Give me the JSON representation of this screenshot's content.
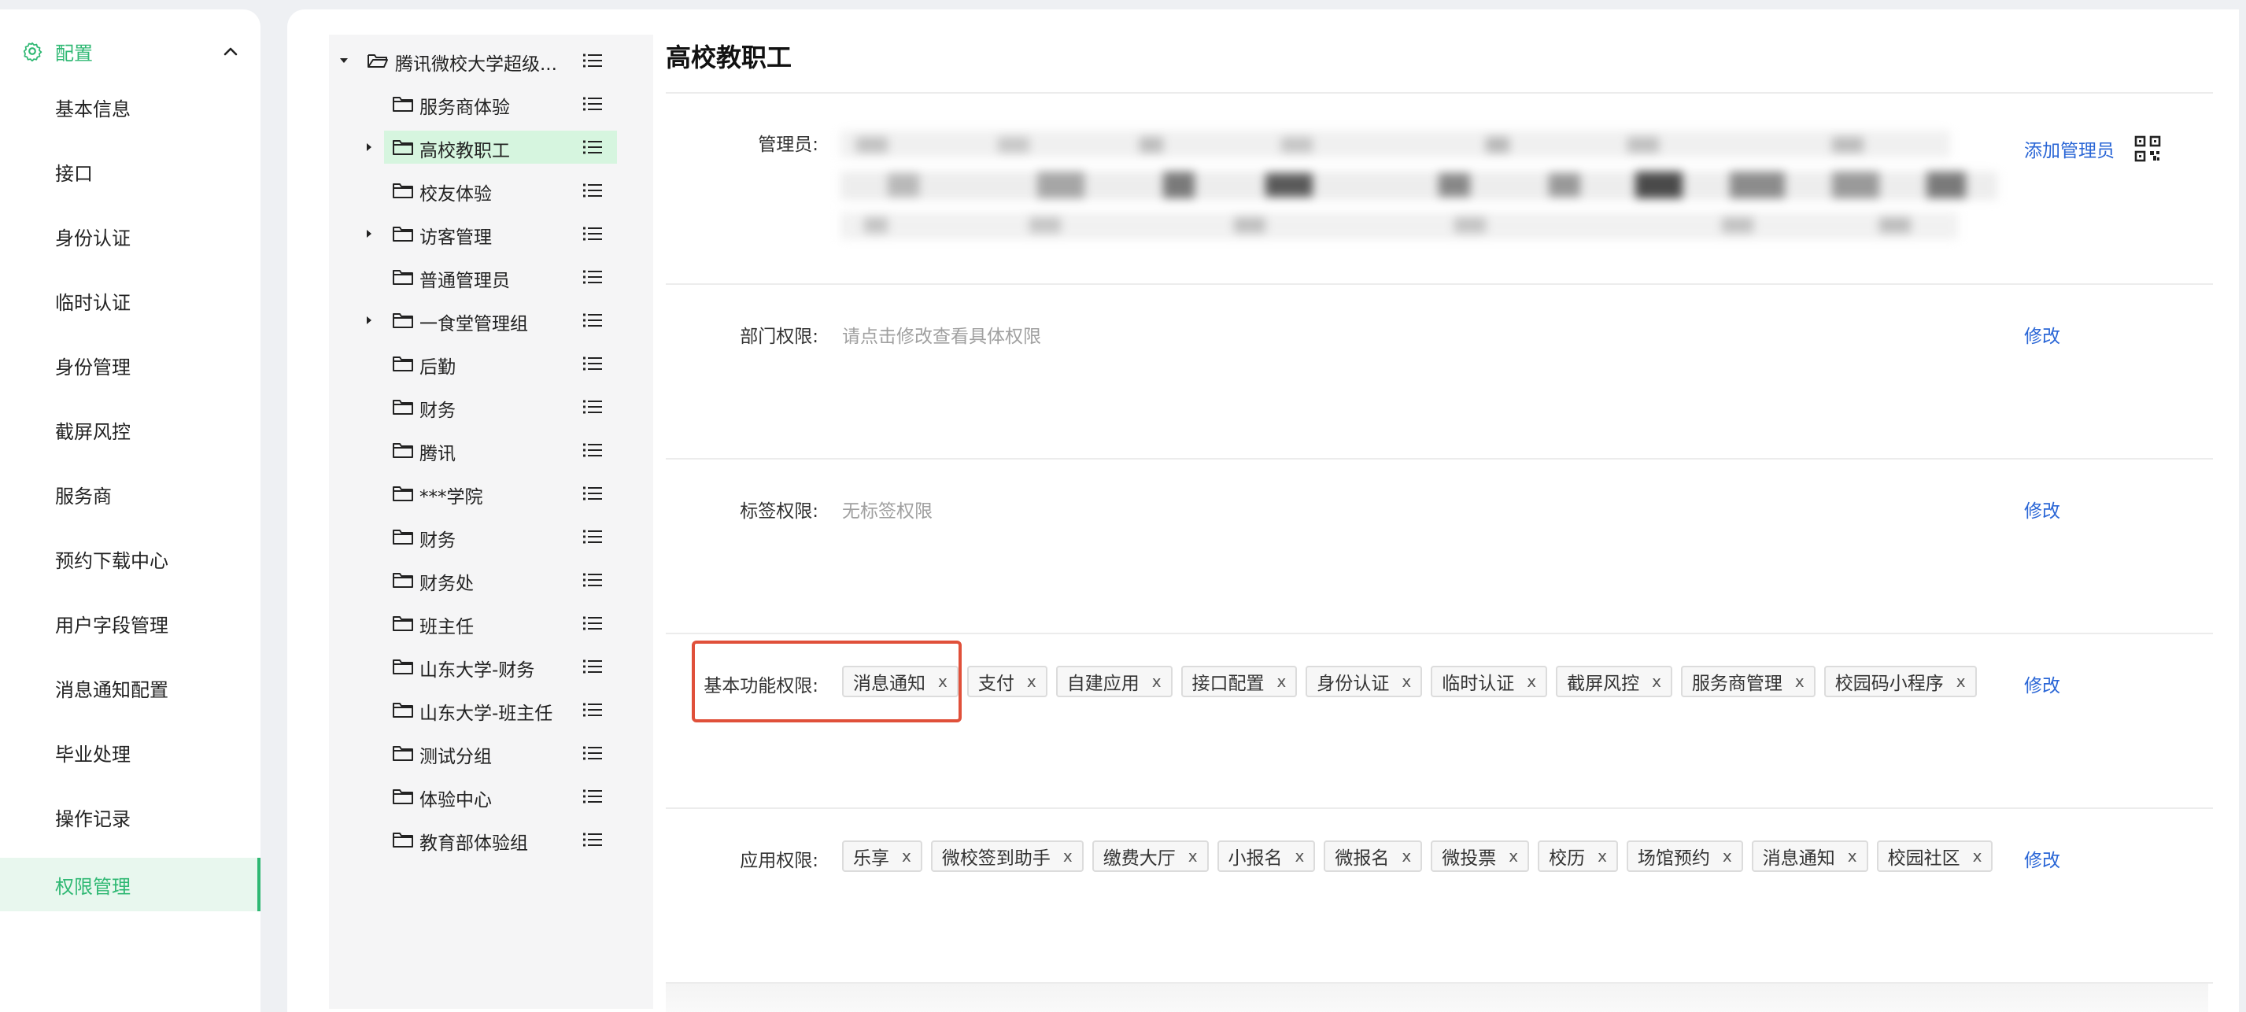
{
  "nav": {
    "group_label": "配置",
    "items": [
      {
        "label": "基本信息"
      },
      {
        "label": "接口"
      },
      {
        "label": "身份认证"
      },
      {
        "label": "临时认证"
      },
      {
        "label": "身份管理"
      },
      {
        "label": "截屏风控"
      },
      {
        "label": "服务商"
      },
      {
        "label": "预约下载中心"
      },
      {
        "label": "用户字段管理"
      },
      {
        "label": "消息通知配置"
      },
      {
        "label": "毕业处理"
      },
      {
        "label": "操作记录"
      },
      {
        "label": "权限管理"
      }
    ],
    "active_item": "权限管理",
    "accent_color": "#2fb873"
  },
  "tree": {
    "root_label": "腾讯微校大学超级...",
    "nodes": [
      {
        "label": "服务商体验",
        "expandable": false
      },
      {
        "label": "高校教职工",
        "expandable": true,
        "selected": true
      },
      {
        "label": "校友体验",
        "expandable": false
      },
      {
        "label": "访客管理",
        "expandable": true
      },
      {
        "label": "普通管理员",
        "expandable": false
      },
      {
        "label": "一食堂管理组",
        "expandable": true
      },
      {
        "label": "后勤",
        "expandable": false
      },
      {
        "label": "财务",
        "expandable": false
      },
      {
        "label": "腾讯",
        "expandable": false
      },
      {
        "label": "***学院",
        "expandable": false
      },
      {
        "label": "财务",
        "expandable": false
      },
      {
        "label": "财务处",
        "expandable": false
      },
      {
        "label": "班主任",
        "expandable": false
      },
      {
        "label": "山东大学-财务",
        "expandable": false
      },
      {
        "label": "山东大学-班主任",
        "expandable": false
      },
      {
        "label": "测试分组",
        "expandable": false
      },
      {
        "label": "体验中心",
        "expandable": false
      },
      {
        "label": "教育部体验组",
        "expandable": false
      }
    ]
  },
  "content": {
    "title": "高校教职工",
    "admins": {
      "label": "管理员:",
      "add_link": "添加管理员"
    },
    "dept": {
      "label": "部门权限:",
      "placeholder": "请点击修改查看具体权限",
      "edit": "修改"
    },
    "tag_perm": {
      "label": "标签权限:",
      "placeholder": "无标签权限",
      "edit": "修改"
    },
    "basic": {
      "label": "基本功能权限:",
      "edit": "修改",
      "tags": [
        "消息通知",
        "支付",
        "自建应用",
        "接口配置",
        "身份认证",
        "临时认证",
        "截屏风控",
        "服务商管理",
        "校园码小程序"
      ]
    },
    "apps": {
      "label": "应用权限:",
      "edit": "修改",
      "tags": [
        "乐享",
        "微校签到助手",
        "缴费大厅",
        "小报名",
        "微报名",
        "微投票",
        "校历",
        "场馆预约",
        "消息通知",
        "校园社区"
      ]
    },
    "tag_close": "x",
    "highlight_color": "#e0503a",
    "link_color": "#2a66d6"
  }
}
